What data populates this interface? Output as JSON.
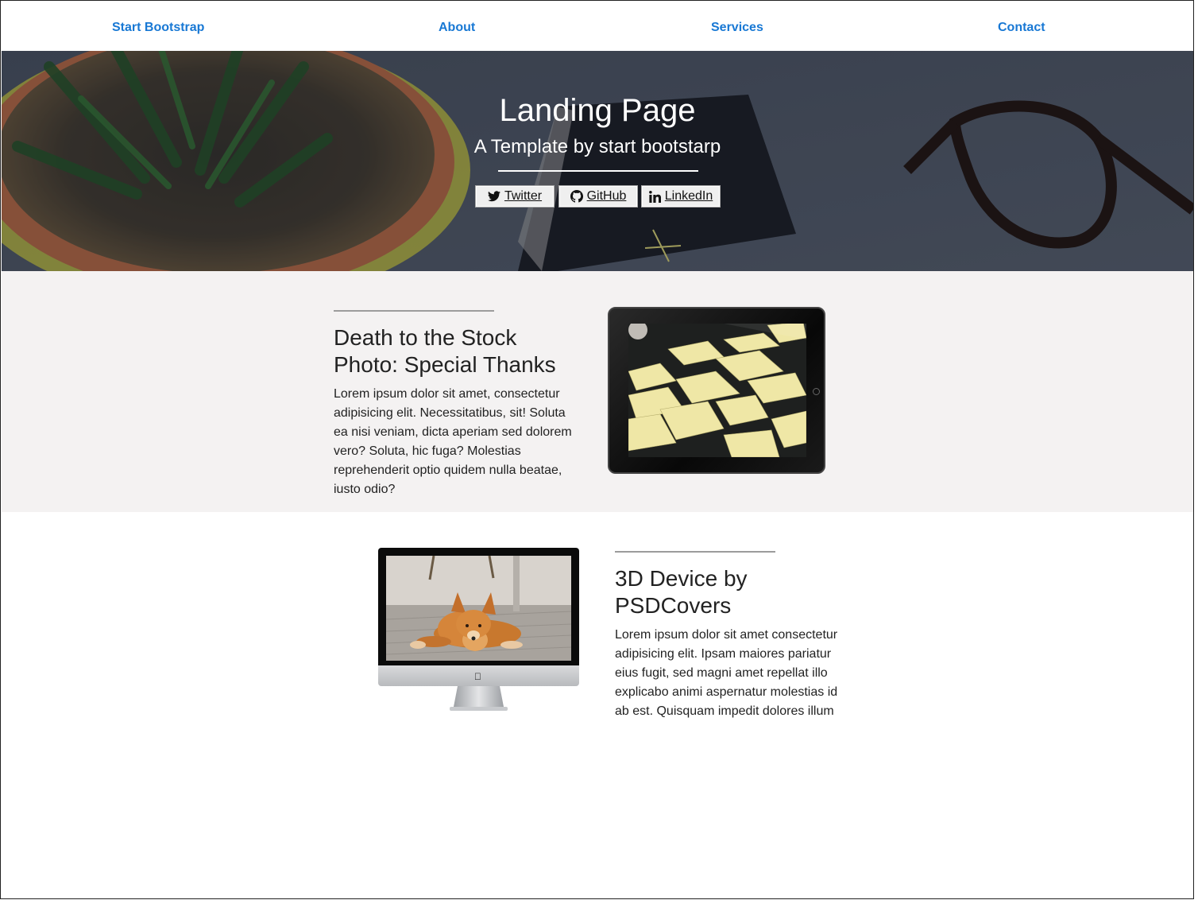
{
  "nav": {
    "brand": "Start Bootstrap",
    "items": [
      "About",
      "Services",
      "Contact"
    ]
  },
  "hero": {
    "title": "Landing Page",
    "subtitle": "A Template by start bootstarp",
    "buttons": [
      {
        "label": "Twitter",
        "icon": "twitter-icon"
      },
      {
        "label": "GitHub",
        "icon": "github-icon"
      },
      {
        "label": "LinkedIn",
        "icon": "linkedin-icon"
      }
    ]
  },
  "section1": {
    "heading": "Death to the Stock Photo: Special Thanks",
    "body": "Lorem ipsum dolor sit amet, consectetur adipisicing elit. Necessitatibus, sit! Soluta ea nisi veniam, dicta aperiam sed dolorem vero? Soluta, hic fuga? Molestias reprehenderit optio quidem nulla beatae, iusto odio?",
    "image": "ipad-image"
  },
  "section2": {
    "heading": "3D Device by PSDCovers",
    "body": "Lorem ipsum dolor sit amet consectetur adipisicing elit. Ipsam maiores pariatur eius fugit, sed magni amet repellat illo explicabo animi aspernatur molestias id ab est. Quisquam impedit dolores illum",
    "image": "imac-image"
  },
  "colors": {
    "link": "#1878d4",
    "section_alt_bg": "#f4f2f2"
  }
}
